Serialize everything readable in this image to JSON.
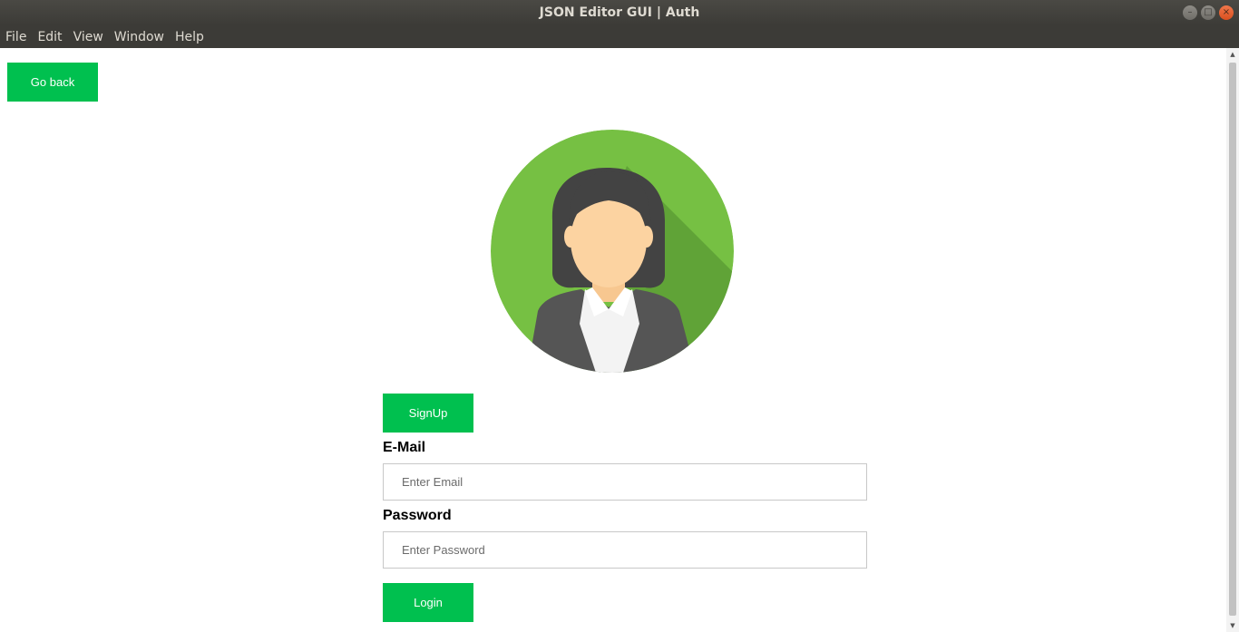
{
  "window": {
    "title": "JSON Editor GUI | Auth",
    "controls": {
      "minimize": "–",
      "maximize": "□",
      "close": "×"
    }
  },
  "menu": [
    "File",
    "Edit",
    "View",
    "Window",
    "Help"
  ],
  "page": {
    "go_back_label": "Go back",
    "avatar_icon": "woman-avatar-icon",
    "signup_label": "SignUp",
    "email_label": "E-Mail",
    "email_placeholder": "Enter Email",
    "password_label": "Password",
    "password_placeholder": "Enter Password",
    "login_label": "Login"
  },
  "colors": {
    "accent": "#00c04f",
    "avatar_bg": "#76c043",
    "titlebar": "#3c3b37"
  },
  "scrollbar": {
    "up": "▲",
    "down": "▼"
  }
}
